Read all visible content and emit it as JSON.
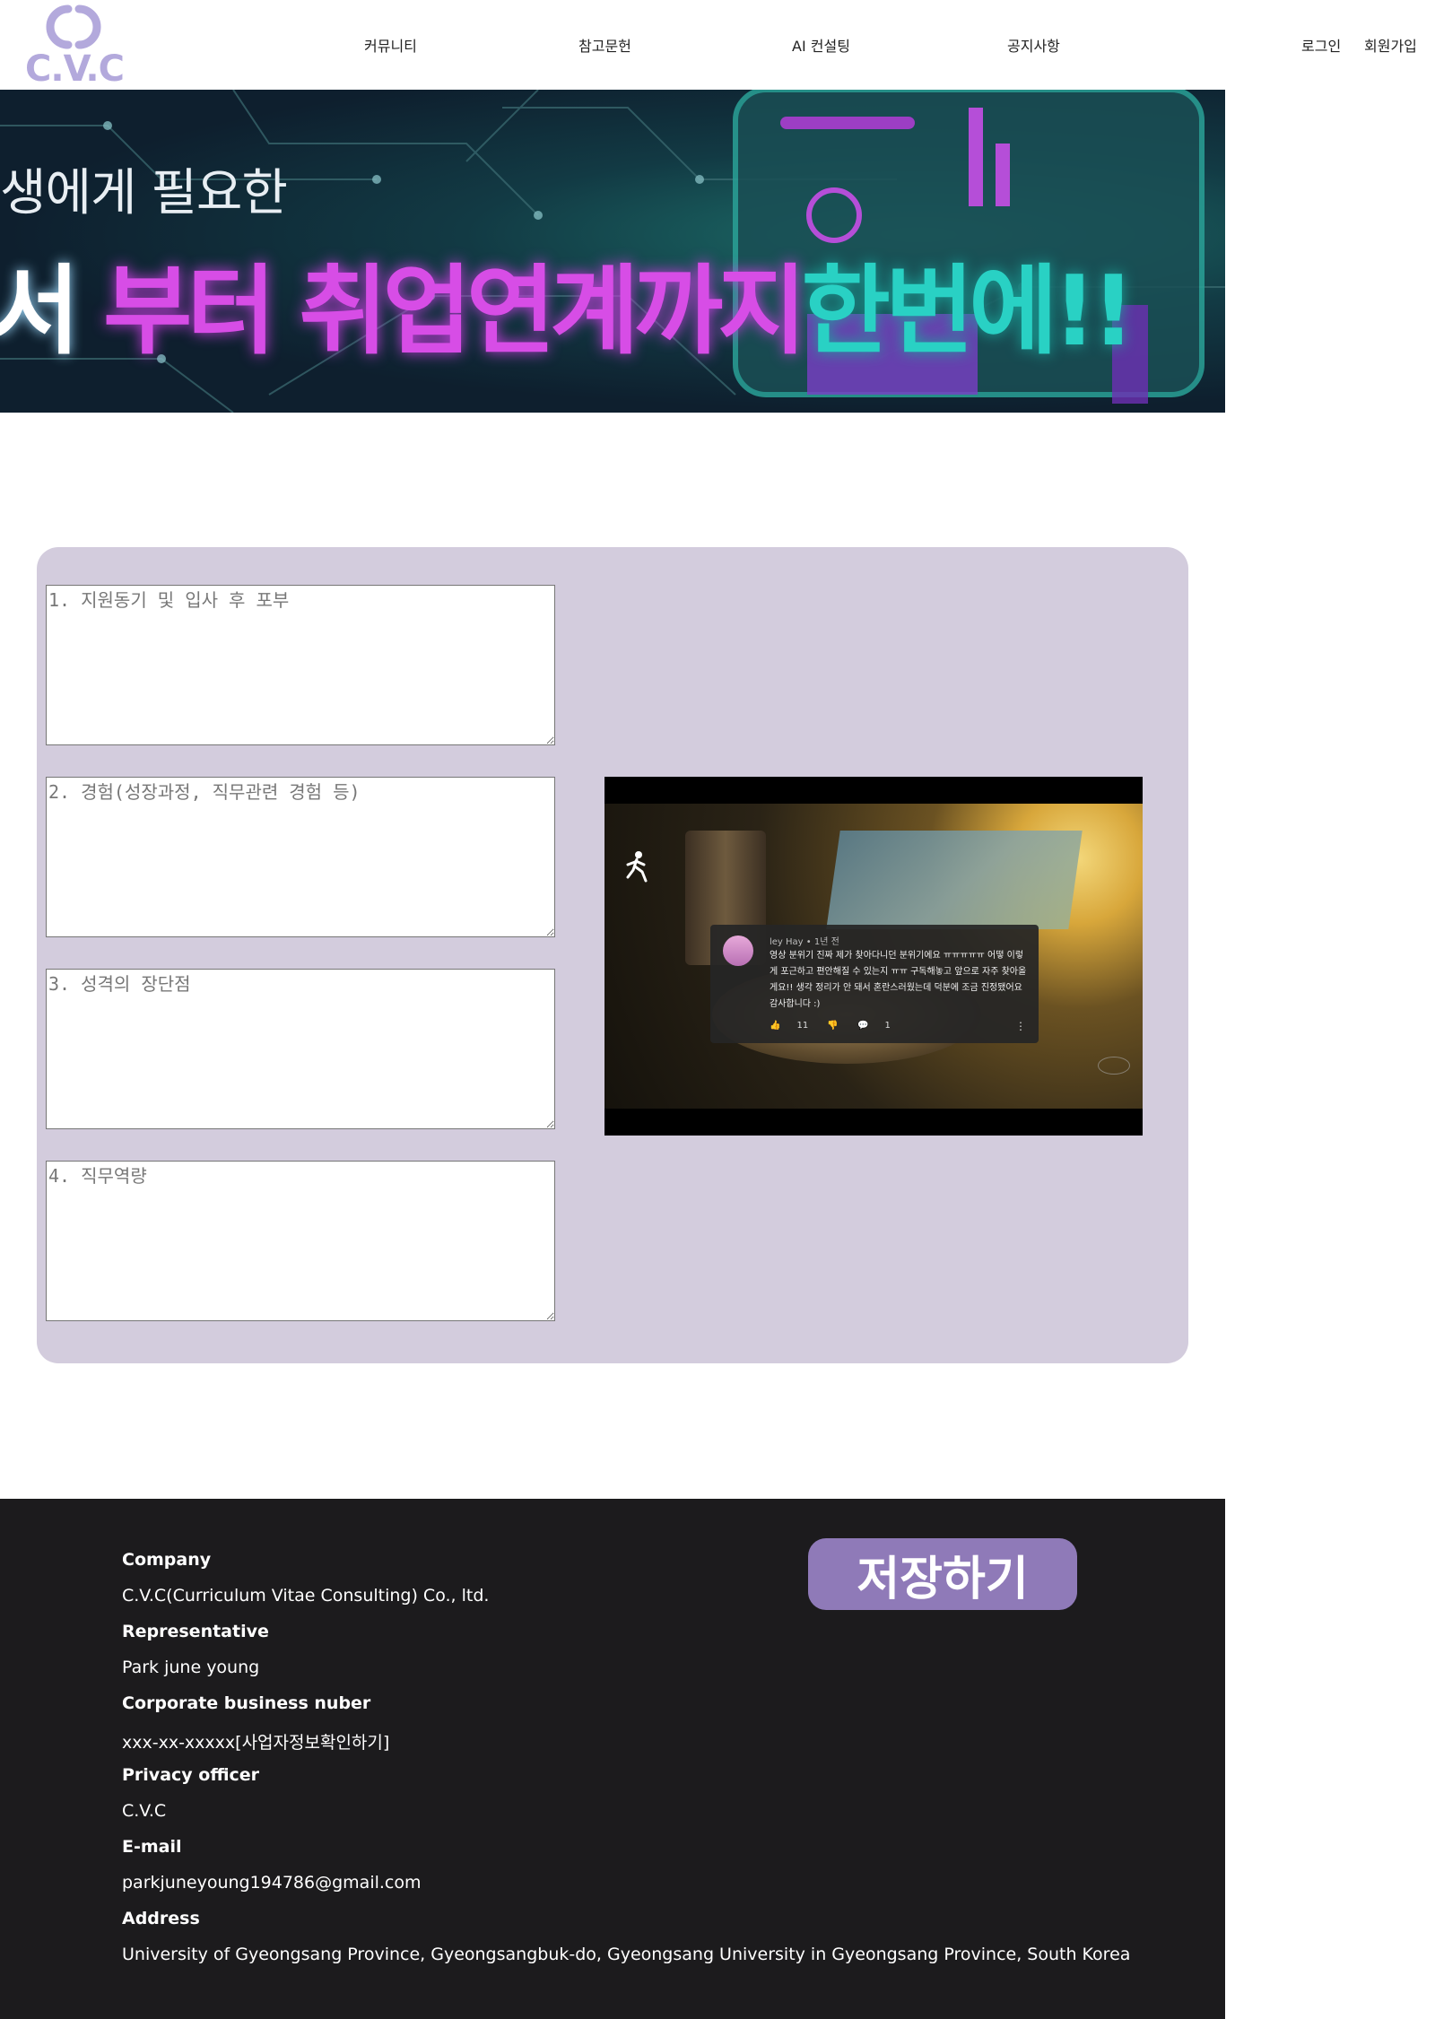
{
  "header": {
    "logo_text": "C.V.C",
    "nav": [
      "커뮤니티",
      "참고문헌",
      "AI 컨설팅",
      "공지사항"
    ],
    "login": "로그인",
    "signup": "회원가입"
  },
  "banner": {
    "line1": "생에게 필요한",
    "line2_white": "서",
    "line2_pink": " 부터 취업연계까지",
    "line2_green": "한번에!!"
  },
  "form": {
    "fields": [
      {
        "placeholder": "1. 지원동기 및 입사 후 포부",
        "value": ""
      },
      {
        "placeholder": "2. 경험(성장과정, 직무관련 경험 등)",
        "value": ""
      },
      {
        "placeholder": "3. 성격의 장단점",
        "value": ""
      },
      {
        "placeholder": "4. 직무역량",
        "value": ""
      }
    ]
  },
  "video": {
    "comment": {
      "meta": "ley Hay • 1년 전",
      "text": "영상 분위기 진짜 제가 찾아다니던 분위기에요 ㅠㅠㅠㅠㅠ 어떻 이렇게 포근하고 편안해질 수 있는지 ㅠㅠ 구독해놓고 앞으로 자주 찾아올게요!! 생각 정리가 안 돼서 혼란스러웠는데 덕분에 조금 진정됐어요 감사합니다 :)",
      "likes": "11",
      "replies": "1"
    }
  },
  "footer": {
    "company_label": "Company",
    "company_value": "C.V.C(Curriculum Vitae Consulting) Co., ltd.",
    "rep_label": "Representative",
    "rep_value": "Park june young",
    "biz_label": "Corporate business nuber",
    "biz_value": "xxx-xx-xxxxx[사업자정보확인하기]",
    "privacy_label": "Privacy officer",
    "privacy_value": "C.V.C",
    "email_label": "E-mail",
    "email_value": "parkjuneyoung194786@gmail.com",
    "address_label": "Address",
    "address_value": "University of Gyeongsang Province, Gyeongsangbuk-do, Gyeongsang University in Gyeongsang Province, South Korea",
    "save_button": "저장하기"
  },
  "colors": {
    "brand": "#b3a9dc",
    "panel": "#d3ccdd",
    "footer_bg": "#1c1b1d",
    "save_button": "#8f7ab8"
  }
}
